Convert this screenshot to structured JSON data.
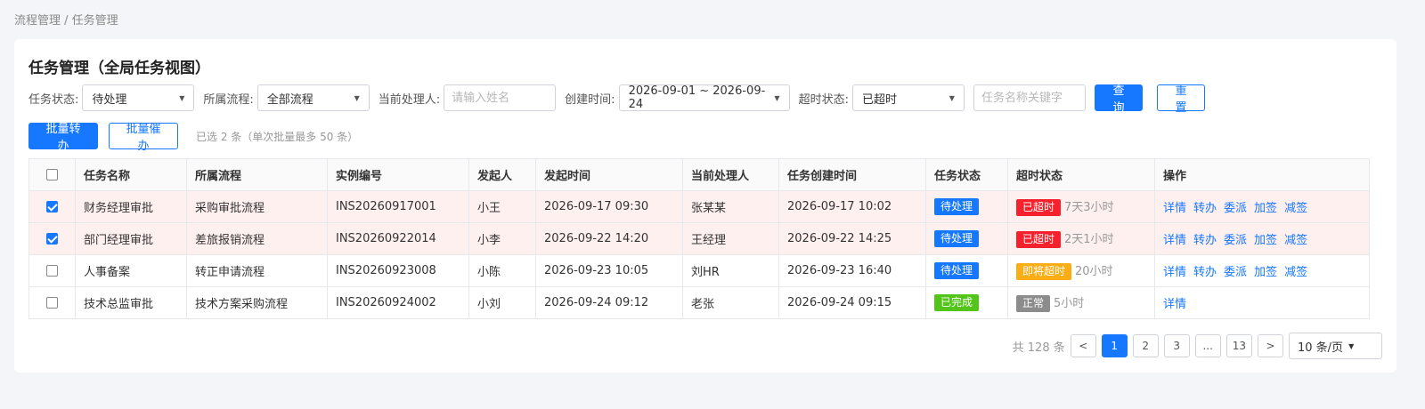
{
  "breadcrumb": "流程管理 / 任务管理",
  "title": "任务管理（全局任务视图）",
  "filters": {
    "status_label": "任务状态:",
    "status_value": "待处理",
    "process_label": "所属流程:",
    "process_value": "全部流程",
    "handler_label": "当前处理人:",
    "handler_placeholder": "请输入姓名",
    "created_label": "创建时间:",
    "created_value": "2026-09-01 ~ 2026-09-24",
    "overdue_label": "超时状态:",
    "overdue_value": "已超时",
    "keyword_placeholder": "任务名称关键字",
    "query_label": "查询",
    "reset_label": "重置"
  },
  "batch": {
    "transfer_label": "批量转办",
    "remind_label": "批量催办",
    "selected_info": "已选 2 条（单次批量最多 50 条）"
  },
  "table": {
    "headers": [
      "任务名称",
      "所属流程",
      "实例编号",
      "发起人",
      "发起时间",
      "当前处理人",
      "任务创建时间",
      "任务状态",
      "超时状态",
      "操作"
    ],
    "rows": [
      {
        "checked": true,
        "name": "财务经理审批",
        "process": "采购审批流程",
        "instance": "INS20260917001",
        "initiator": "小王",
        "start_time": "2026-09-17 09:30",
        "handler": "张某某",
        "created_time": "2026-09-17 10:02",
        "status": "待处理",
        "overdue": "已超时",
        "duration": "7天3小时",
        "actions": [
          "详情",
          "转办",
          "委派",
          "加签",
          "减签"
        ]
      },
      {
        "checked": true,
        "name": "部门经理审批",
        "process": "差旅报销流程",
        "instance": "INS20260922014",
        "initiator": "小李",
        "start_time": "2026-09-22 14:20",
        "handler": "王经理",
        "created_time": "2026-09-22 14:25",
        "status": "待处理",
        "overdue": "已超时",
        "duration": "2天1小时",
        "actions": [
          "详情",
          "转办",
          "委派",
          "加签",
          "减签"
        ]
      },
      {
        "checked": false,
        "name": "人事备案",
        "process": "转正申请流程",
        "instance": "INS20260923008",
        "initiator": "小陈",
        "start_time": "2026-09-23 10:05",
        "handler": "刘HR",
        "created_time": "2026-09-23 16:40",
        "status": "待处理",
        "overdue": "即将超时",
        "duration": "20小时",
        "actions": [
          "详情",
          "转办",
          "委派",
          "加签",
          "减签"
        ]
      },
      {
        "checked": false,
        "name": "技术总监审批",
        "process": "技术方案采购流程",
        "instance": "INS20260924002",
        "initiator": "小刘",
        "start_time": "2026-09-24 09:12",
        "handler": "老张",
        "created_time": "2026-09-24 09:15",
        "status": "已完成",
        "overdue": "正常",
        "duration": "5小时",
        "actions": [
          "详情"
        ]
      }
    ]
  },
  "colors": {
    "primary": "#1677ff",
    "status_pending": "#1677ff",
    "status_done": "#52c41a",
    "overdue": "#f5222d",
    "near_overdue": "#faad14",
    "normal": "#8c8c8c"
  },
  "pagination": {
    "total": "共 128 条",
    "prev": "<",
    "pages": [
      "1",
      "2",
      "3",
      "...",
      "13"
    ],
    "next": ">",
    "active_page": "1",
    "page_size": "10 条/页"
  }
}
